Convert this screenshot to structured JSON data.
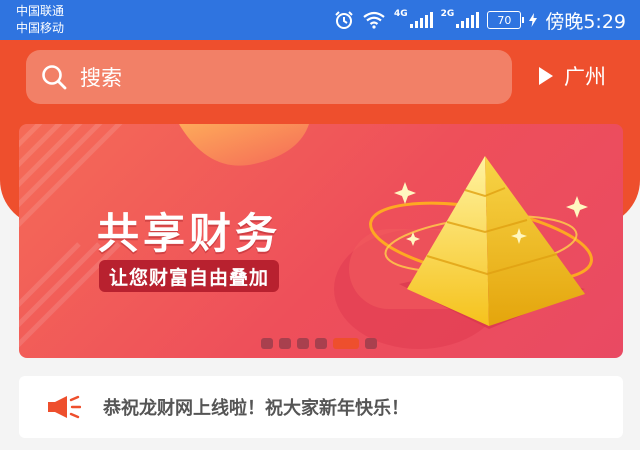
{
  "status_bar": {
    "carrier_1": "中国联通",
    "carrier_2": "中国移动",
    "network_1": "4G",
    "network_2": "2G",
    "battery": "70",
    "time": "傍晚5:29"
  },
  "header": {
    "search_placeholder": "搜索",
    "location_label": "广州",
    "background_color": "#ee4f2d"
  },
  "banner": {
    "title": "共享财务",
    "subtitle": "让您财富自由叠加",
    "dot_count": 6,
    "active_dot_index": 4
  },
  "notice": {
    "icon": "megaphone-icon",
    "text": "恭祝龙财网上线啦！祝大家新年快乐！"
  }
}
